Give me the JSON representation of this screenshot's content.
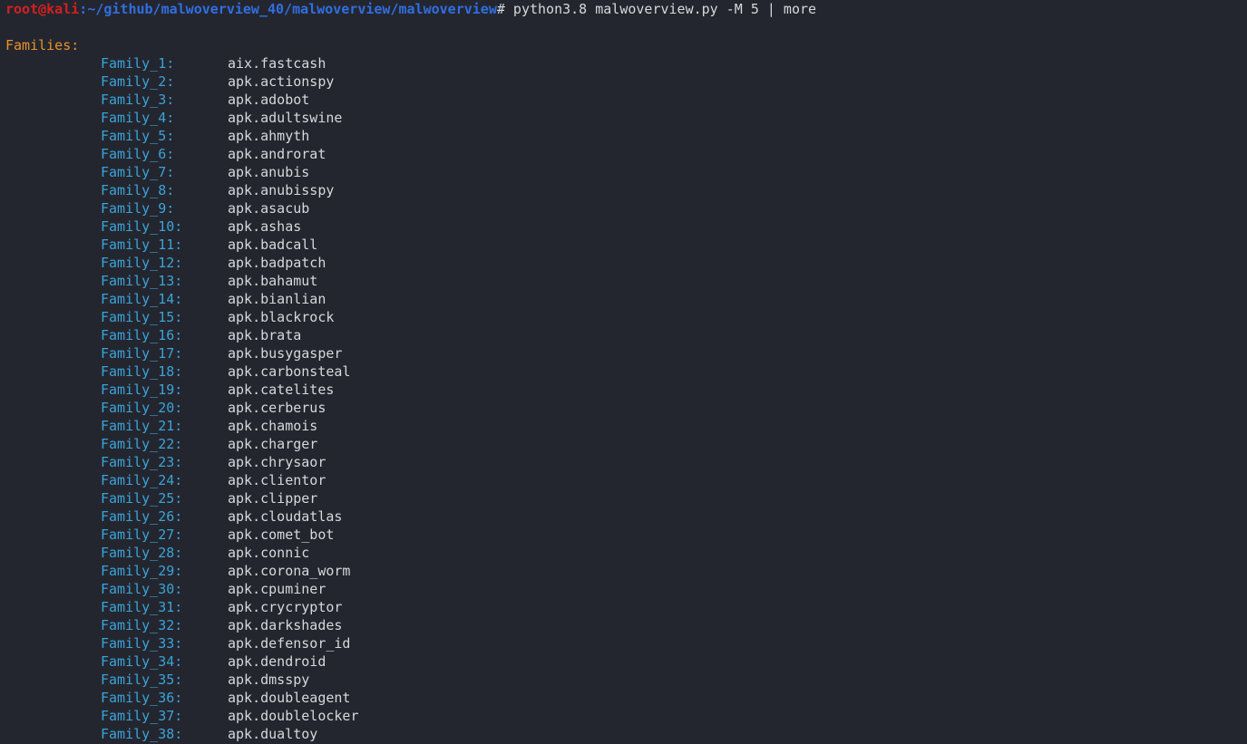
{
  "terminal": {
    "background_color": "#24262f",
    "prompt": {
      "user_host": "root@kali",
      "separator": ":",
      "path": "~/github/malwoverview_40/malwoverview/malwoverview",
      "sigil": "#",
      "command": " python3.8 malwoverview.py -M 5 | more"
    },
    "colors": {
      "user_host": "#d32020",
      "path": "#2f6fe0",
      "command": "#d5d8dd",
      "section_header": "#e8922a",
      "family_key": "#3aa3d8",
      "family_value": "#d5d8dd"
    },
    "output": {
      "section_title": "Families:",
      "families": [
        {
          "key": "Family_1:",
          "value": "aix.fastcash"
        },
        {
          "key": "Family_2:",
          "value": "apk.actionspy"
        },
        {
          "key": "Family_3:",
          "value": "apk.adobot"
        },
        {
          "key": "Family_4:",
          "value": "apk.adultswine"
        },
        {
          "key": "Family_5:",
          "value": "apk.ahmyth"
        },
        {
          "key": "Family_6:",
          "value": "apk.androrat"
        },
        {
          "key": "Family_7:",
          "value": "apk.anubis"
        },
        {
          "key": "Family_8:",
          "value": "apk.anubisspy"
        },
        {
          "key": "Family_9:",
          "value": "apk.asacub"
        },
        {
          "key": "Family_10:",
          "value": "apk.ashas"
        },
        {
          "key": "Family_11:",
          "value": "apk.badcall"
        },
        {
          "key": "Family_12:",
          "value": "apk.badpatch"
        },
        {
          "key": "Family_13:",
          "value": "apk.bahamut"
        },
        {
          "key": "Family_14:",
          "value": "apk.bianlian"
        },
        {
          "key": "Family_15:",
          "value": "apk.blackrock"
        },
        {
          "key": "Family_16:",
          "value": "apk.brata"
        },
        {
          "key": "Family_17:",
          "value": "apk.busygasper"
        },
        {
          "key": "Family_18:",
          "value": "apk.carbonsteal"
        },
        {
          "key": "Family_19:",
          "value": "apk.catelites"
        },
        {
          "key": "Family_20:",
          "value": "apk.cerberus"
        },
        {
          "key": "Family_21:",
          "value": "apk.chamois"
        },
        {
          "key": "Family_22:",
          "value": "apk.charger"
        },
        {
          "key": "Family_23:",
          "value": "apk.chrysaor"
        },
        {
          "key": "Family_24:",
          "value": "apk.clientor"
        },
        {
          "key": "Family_25:",
          "value": "apk.clipper"
        },
        {
          "key": "Family_26:",
          "value": "apk.cloudatlas"
        },
        {
          "key": "Family_27:",
          "value": "apk.comet_bot"
        },
        {
          "key": "Family_28:",
          "value": "apk.connic"
        },
        {
          "key": "Family_29:",
          "value": "apk.corona_worm"
        },
        {
          "key": "Family_30:",
          "value": "apk.cpuminer"
        },
        {
          "key": "Family_31:",
          "value": "apk.crycryptor"
        },
        {
          "key": "Family_32:",
          "value": "apk.darkshades"
        },
        {
          "key": "Family_33:",
          "value": "apk.defensor_id"
        },
        {
          "key": "Family_34:",
          "value": "apk.dendroid"
        },
        {
          "key": "Family_35:",
          "value": "apk.dmsspy"
        },
        {
          "key": "Family_36:",
          "value": "apk.doubleagent"
        },
        {
          "key": "Family_37:",
          "value": "apk.doublelocker"
        },
        {
          "key": "Family_38:",
          "value": "apk.dualtoy"
        }
      ]
    }
  }
}
